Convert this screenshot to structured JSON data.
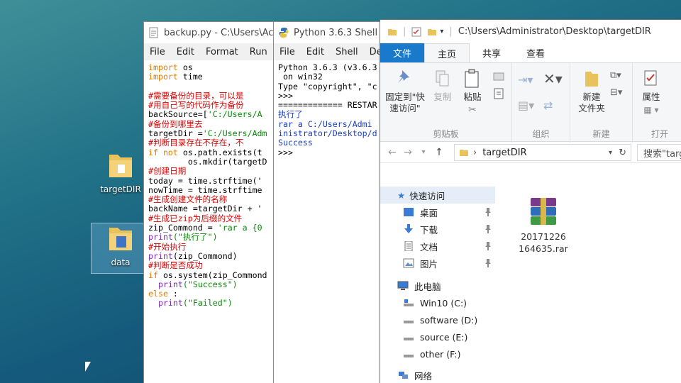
{
  "desktop": {
    "icons": [
      {
        "label": "targetDIR",
        "selected": false
      },
      {
        "label": "data",
        "selected": true
      }
    ]
  },
  "idle_editor": {
    "title": "backup.py - C:\\Users\\Ac",
    "menu": [
      "File",
      "Edit",
      "Format",
      "Run"
    ],
    "lines": [
      [
        [
          "kw",
          "import"
        ],
        [
          "nm",
          " os"
        ]
      ],
      [
        [
          "kw",
          "import"
        ],
        [
          "nm",
          " time"
        ]
      ],
      [
        [
          "nm",
          ""
        ]
      ],
      [
        [
          "cm",
          "#需要备份的目录，可以是"
        ]
      ],
      [
        [
          "cm",
          "#用自己写的代码作为备份"
        ]
      ],
      [
        [
          "nm",
          "backSource=["
        ],
        [
          "st",
          "'C:/Users/A"
        ]
      ],
      [
        [
          "cm",
          "#备份到哪里去"
        ]
      ],
      [
        [
          "nm",
          "targetDir ="
        ],
        [
          "st",
          "'C:/Users/Adm"
        ]
      ],
      [
        [
          "cm",
          "#判断目录存在不存在，不"
        ]
      ],
      [
        [
          "kw",
          "if not"
        ],
        [
          "nm",
          " os.path.exists(t"
        ]
      ],
      [
        [
          "nm",
          "        os.mkdir(targetD"
        ]
      ],
      [
        [
          "cm",
          "#创建日期"
        ]
      ],
      [
        [
          "nm",
          "today = time.strftime('"
        ]
      ],
      [
        [
          "nm",
          "nowTime = time.strftime"
        ]
      ],
      [
        [
          "cm",
          "#生成创建文件的名称"
        ]
      ],
      [
        [
          "nm",
          "backName =targetDir + '"
        ]
      ],
      [
        [
          "cm",
          "#生成已zip为后缀的文件"
        ]
      ],
      [
        [
          "nm",
          "zip_Commond = "
        ],
        [
          "st",
          "'rar a {0"
        ]
      ],
      [
        [
          "bl",
          "print"
        ],
        [
          "st",
          "(\"执行了\")"
        ]
      ],
      [
        [
          "cm",
          "#开始执行"
        ]
      ],
      [
        [
          "bl",
          "print"
        ],
        [
          "nm",
          "(zip_Commond)"
        ]
      ],
      [
        [
          "cm",
          "#判断是否成功"
        ]
      ],
      [
        [
          "kw",
          "if"
        ],
        [
          "nm",
          " os.system(zip_Commond"
        ]
      ],
      [
        [
          "nm",
          "  "
        ],
        [
          "bl",
          "print"
        ],
        [
          "st",
          "(\"Success\")"
        ]
      ],
      [
        [
          "kw",
          "else"
        ],
        [
          "nm",
          " :"
        ]
      ],
      [
        [
          "nm",
          "  "
        ],
        [
          "bl",
          "print"
        ],
        [
          "st",
          "(\"Failed\")"
        ]
      ]
    ]
  },
  "idle_shell": {
    "title": "Python 3.6.3 Shell",
    "menu": [
      "File",
      "Edit",
      "Shell",
      "Debu"
    ],
    "lines": [
      [
        [
          "nm",
          "Python 3.6.3 (v3.6.3"
        ]
      ],
      [
        [
          "nm",
          " on win32"
        ]
      ],
      [
        [
          "nm",
          "Type \"copyright\", \"c"
        ]
      ],
      [
        [
          "nm",
          ">>> "
        ]
      ],
      [
        [
          "nm",
          "============= RESTAR"
        ]
      ],
      [
        [
          "sin",
          "执行了"
        ]
      ],
      [
        [
          "sin",
          "rar a C:/Users/Admi"
        ]
      ],
      [
        [
          "sin",
          "inistrator/Desktop/d"
        ]
      ],
      [
        [
          "sin",
          "Success"
        ]
      ],
      [
        [
          "nm",
          ">>> "
        ]
      ]
    ]
  },
  "explorer": {
    "title": "C:\\Users\\Administrator\\Desktop\\targetDIR",
    "tabs": [
      "文件",
      "主页",
      "共享",
      "查看"
    ],
    "ribbon": {
      "pin_label": "固定到\"快\n速访问\"",
      "copy_label": "复制",
      "paste_label": "粘贴",
      "new_folder_label": "新建\n文件夹",
      "properties_label": "属性",
      "group_clipboard": "剪贴板",
      "group_organize": "组织",
      "group_new": "新建",
      "group_open": "打开"
    },
    "address": "targetDIR",
    "search_placeholder": "搜索\"targ",
    "nav": {
      "quick_access": "快速访问",
      "quick_items": [
        "桌面",
        "下载",
        "文档",
        "图片"
      ],
      "this_pc": "此电脑",
      "drives": [
        "Win10 (C:)",
        "software (D:)",
        "source (E:)",
        "other (F:)"
      ],
      "network": "网络"
    },
    "file": {
      "name_line1": "20171226",
      "name_line2": "164635.rar"
    }
  }
}
